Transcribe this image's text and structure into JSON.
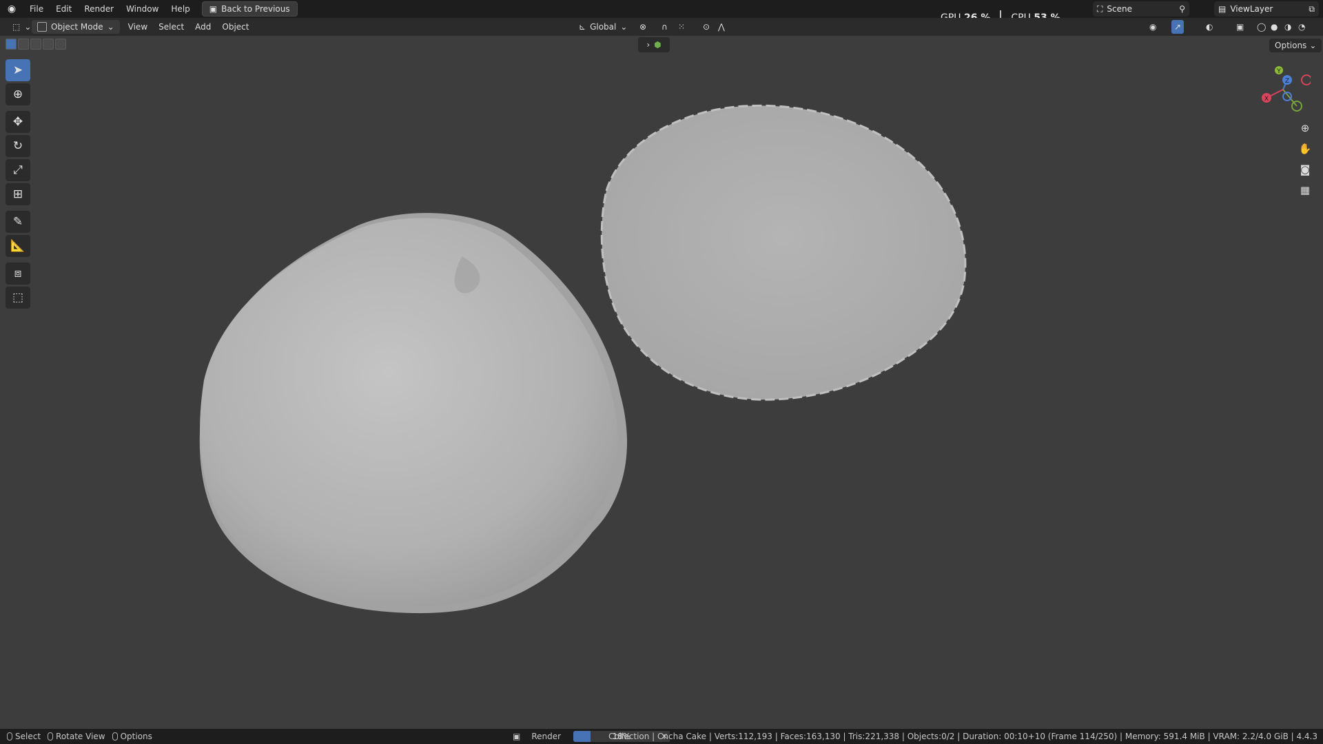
{
  "topbar": {
    "menus": [
      "File",
      "Edit",
      "Render",
      "Window",
      "Help"
    ],
    "back_button": "Back to Previous",
    "gpu_label": "GPU",
    "gpu_value": "26 %",
    "cpu_label": "CPU",
    "cpu_value": "53 %",
    "scene": "Scene",
    "view_layer": "ViewLayer"
  },
  "header": {
    "mode": "Object Mode",
    "menus": [
      "View",
      "Select",
      "Add",
      "Object"
    ],
    "transform_orientation": "Global",
    "options": "Options"
  },
  "statusbar": {
    "select": "Select",
    "rotate_view": "Rotate View",
    "options": "Options",
    "render_label": "Render",
    "progress_text": "18%",
    "progress_value": 0.18,
    "info": "Collection | Cncha Cake | Verts:112,193 | Faces:163,130 | Tris:221,338 | Objects:0/2 | Duration: 00:10+10 (Frame 114/250) | Memory: 591.4 MiB | VRAM: 2.2/4.0 GiB | 4.4.3"
  },
  "gizmo": {
    "x": "X",
    "y": "Y",
    "z": "Z"
  },
  "colors": {
    "accent": "#4772b3",
    "viewport": "#3d3d3d",
    "mesh": "#b3b3b3"
  }
}
